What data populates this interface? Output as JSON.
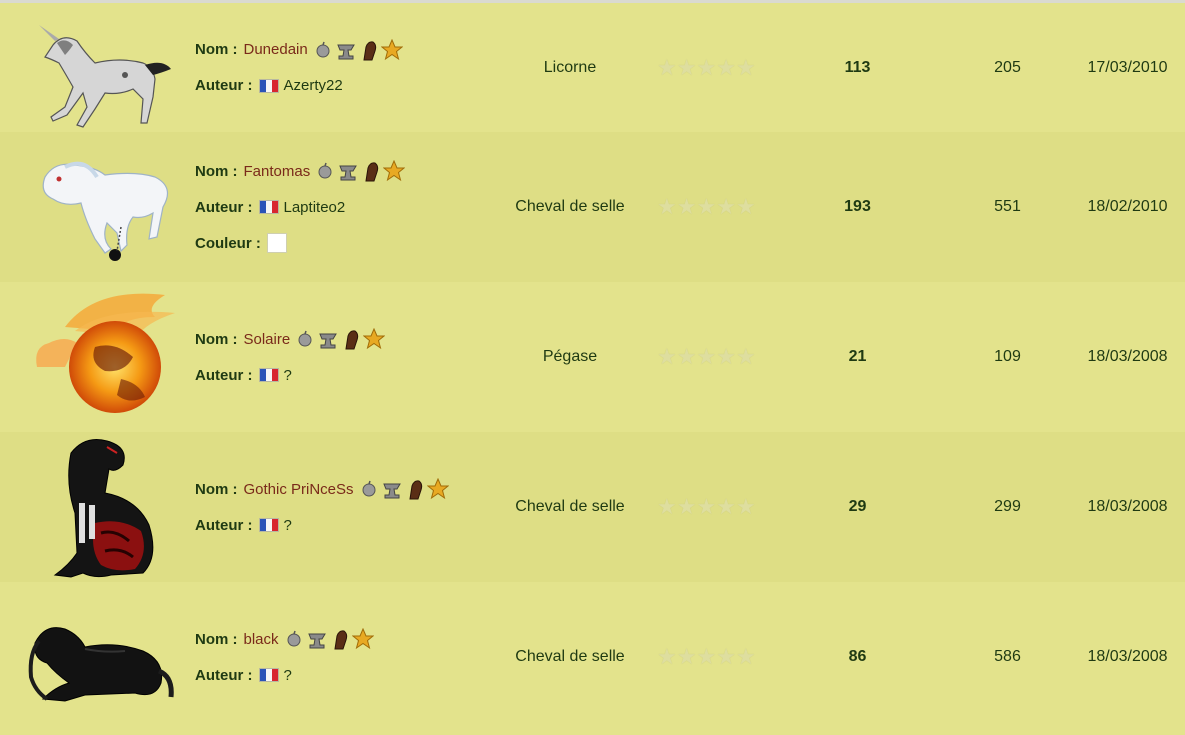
{
  "labels": {
    "nom": "Nom :",
    "auteur": "Auteur :",
    "couleur": "Couleur :"
  },
  "rows": [
    {
      "name": "Dunedain",
      "author": "Azerty22",
      "race": "Licorne",
      "votes": "113",
      "views": "205",
      "date": "17/03/2010",
      "image": "white-unicorn-trotting",
      "has_color": false
    },
    {
      "name": "Fantomas",
      "author": "Laptiteo2",
      "race": "Cheval de selle",
      "votes": "193",
      "views": "551",
      "date": "18/02/2010",
      "image": "ghost-horse-ball-chain",
      "has_color": true,
      "color": "#ffffff"
    },
    {
      "name": "Solaire",
      "author": "?",
      "race": "Pégase",
      "votes": "21",
      "views": "109",
      "date": "18/03/2008",
      "image": "fire-pegasus-sun",
      "has_color": false
    },
    {
      "name": "Gothic PriNceSs",
      "author": "?",
      "race": "Cheval de selle",
      "votes": "29",
      "views": "299",
      "date": "18/03/2008",
      "image": "gothic-black-horse-sitting",
      "has_color": false
    },
    {
      "name": "black",
      "author": "?",
      "race": "Cheval de selle",
      "votes": "86",
      "views": "586",
      "date": "18/03/2008",
      "image": "black-horse-lying",
      "has_color": false
    }
  ],
  "rating": {
    "stars_total": 5,
    "stars_filled": 0
  },
  "icons": [
    "apple-icon",
    "anvil-icon",
    "horse-head-icon",
    "star-icon",
    "france-flag-icon"
  ],
  "colors": {
    "background_odd": "#e3e38c",
    "background_even": "#dede85",
    "name_color": "#7a2a1a",
    "label_color": "#1f3a12"
  }
}
